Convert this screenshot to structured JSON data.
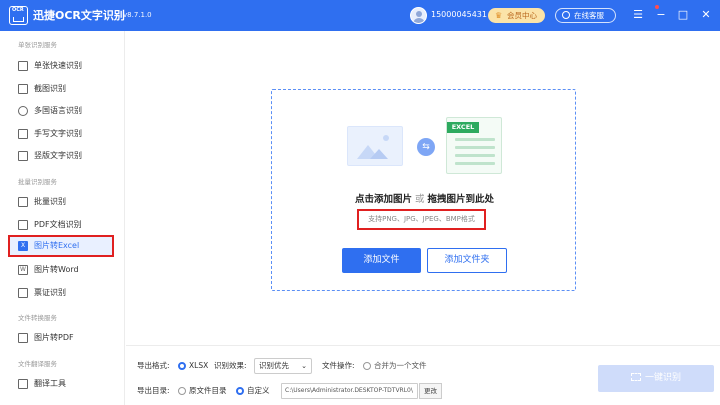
{
  "titlebar": {
    "logo_text": "OCR",
    "app_title": "迅捷OCR文字识别",
    "version": "v8.7.1.0",
    "phone": "15000045431",
    "vip_label": "会员中心",
    "service_label": "在线客服",
    "accent_color": "#2f6ff0"
  },
  "sidebar": {
    "sections": [
      {
        "title": "单张识别服务",
        "items": [
          {
            "label": "单张快速识别",
            "icon": "image-icon"
          },
          {
            "label": "截图识别",
            "icon": "crop-icon"
          },
          {
            "label": "多国语言识别",
            "icon": "globe-icon"
          },
          {
            "label": "手写文字识别",
            "icon": "pen-icon"
          },
          {
            "label": "竖版文字识别",
            "icon": "vertical-text-icon"
          }
        ]
      },
      {
        "title": "批量识别服务",
        "items": [
          {
            "label": "批量识别",
            "icon": "batch-icon"
          },
          {
            "label": "PDF文档识别",
            "icon": "pdf-icon"
          },
          {
            "label": "图片转Excel",
            "icon": "excel-icon"
          },
          {
            "label": "图片转Word",
            "icon": "word-icon"
          },
          {
            "label": "票证识别",
            "icon": "ticket-icon"
          }
        ]
      },
      {
        "title": "文件转换服务",
        "items": [
          {
            "label": "图片转PDF",
            "icon": "pdf-convert-icon"
          }
        ]
      },
      {
        "title": "文件翻译服务",
        "items": [
          {
            "label": "翻译工具",
            "icon": "translate-icon"
          }
        ]
      }
    ]
  },
  "dropzone": {
    "excel_tag": "EXCEL",
    "title_click": "点击添加图片",
    "title_or": "或",
    "title_drag": "拖拽图片到此处",
    "formats": "支持PNG、JPG、JPEG、BMP格式",
    "add_file": "添加文件",
    "add_folder": "添加文件夹"
  },
  "bottom": {
    "export_format_label": "导出格式:",
    "export_format_value": "XLSX",
    "recog_effect_label": "识别效果:",
    "recog_effect_value": "识别优先",
    "file_op_label": "文件操作:",
    "merge_label": "合并为一个文件",
    "export_dir_label": "导出目录:",
    "orig_dir_label": "原文件目录",
    "custom_label": "自定义",
    "path": "C:\\Users\\Administrator.DESKTOP-TDTVRL0\\",
    "change_label": "更改",
    "ocr_button": "一键识别"
  }
}
